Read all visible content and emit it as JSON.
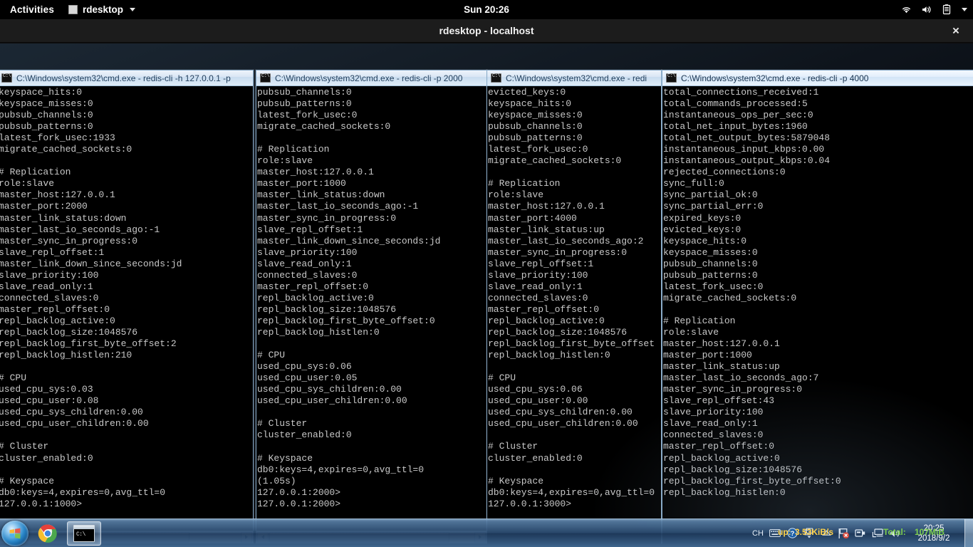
{
  "gnome_bar": {
    "activities": "Activities",
    "app_name": "rdesktop",
    "clock": "Sun 20:26",
    "tray_icons": [
      "wifi-icon",
      "volume-icon",
      "battery-icon",
      "chevron-down-icon"
    ]
  },
  "rdesktop_window": {
    "title": "rdesktop - localhost",
    "close_label": "×"
  },
  "cmd_windows": [
    {
      "title": "C:\\Windows\\system32\\cmd.exe - redis-cli  -h 127.0.0.1 -p",
      "lines": [
        "keyspace_hits:0",
        "keyspace_misses:0",
        "pubsub_channels:0",
        "pubsub_patterns:0",
        "latest_fork_usec:1933",
        "migrate_cached_sockets:0",
        "",
        "# Replication",
        "role:slave",
        "master_host:127.0.0.1",
        "master_port:2000",
        "master_link_status:down",
        "master_last_io_seconds_ago:-1",
        "master_sync_in_progress:0",
        "slave_repl_offset:1",
        "master_link_down_since_seconds:jd",
        "slave_priority:100",
        "slave_read_only:1",
        "connected_slaves:0",
        "master_repl_offset:0",
        "repl_backlog_active:0",
        "repl_backlog_size:1048576",
        "repl_backlog_first_byte_offset:2",
        "repl_backlog_histlen:210",
        "",
        "# CPU",
        "used_cpu_sys:0.03",
        "used_cpu_user:0.08",
        "used_cpu_sys_children:0.00",
        "used_cpu_user_children:0.00",
        "",
        "# Cluster",
        "cluster_enabled:0",
        "",
        "# Keyspace",
        "db0:keys=4,expires=0,avg_ttl=0",
        "127.0.0.1:1000>"
      ]
    },
    {
      "title": "C:\\Windows\\system32\\cmd.exe - redis-cli  -p 2000",
      "lines": [
        "pubsub_channels:0",
        "pubsub_patterns:0",
        "latest_fork_usec:0",
        "migrate_cached_sockets:0",
        "",
        "# Replication",
        "role:slave",
        "master_host:127.0.0.1",
        "master_port:1000",
        "master_link_status:down",
        "master_last_io_seconds_ago:-1",
        "master_sync_in_progress:0",
        "slave_repl_offset:1",
        "master_link_down_since_seconds:jd",
        "slave_priority:100",
        "slave_read_only:1",
        "connected_slaves:0",
        "master_repl_offset:0",
        "repl_backlog_active:0",
        "repl_backlog_size:1048576",
        "repl_backlog_first_byte_offset:0",
        "repl_backlog_histlen:0",
        "",
        "# CPU",
        "used_cpu_sys:0.06",
        "used_cpu_user:0.05",
        "used_cpu_sys_children:0.00",
        "used_cpu_user_children:0.00",
        "",
        "# Cluster",
        "cluster_enabled:0",
        "",
        "# Keyspace",
        "db0:keys=4,expires=0,avg_ttl=0",
        "(1.05s)",
        "127.0.0.1:2000>",
        "127.0.0.1:2000>"
      ]
    },
    {
      "title": "C:\\Windows\\system32\\cmd.exe - redi",
      "lines": [
        "evicted_keys:0",
        "keyspace_hits:0",
        "keyspace_misses:0",
        "pubsub_channels:0",
        "pubsub_patterns:0",
        "latest_fork_usec:0",
        "migrate_cached_sockets:0",
        "",
        "# Replication",
        "role:slave",
        "master_host:127.0.0.1",
        "master_port:4000",
        "master_link_status:up",
        "master_last_io_seconds_ago:2",
        "master_sync_in_progress:0",
        "slave_repl_offset:1",
        "slave_priority:100",
        "slave_read_only:1",
        "connected_slaves:0",
        "master_repl_offset:0",
        "repl_backlog_active:0",
        "repl_backlog_size:1048576",
        "repl_backlog_first_byte_offset",
        "repl_backlog_histlen:0",
        "",
        "# CPU",
        "used_cpu_sys:0.06",
        "used_cpu_user:0.00",
        "used_cpu_sys_children:0.00",
        "used_cpu_user_children:0.00",
        "",
        "# Cluster",
        "cluster_enabled:0",
        "",
        "# Keyspace",
        "db0:keys=4,expires=0,avg_ttl=0",
        "127.0.0.1:3000>"
      ]
    },
    {
      "title": "C:\\Windows\\system32\\cmd.exe - redis-cli  -p 4000",
      "lines": [
        "total_connections_received:1",
        "total_commands_processed:5",
        "instantaneous_ops_per_sec:0",
        "total_net_input_bytes:1960",
        "total_net_output_bytes:5879048",
        "instantaneous_input_kbps:0.00",
        "instantaneous_output_kbps:0.04",
        "rejected_connections:0",
        "sync_full:0",
        "sync_partial_ok:0",
        "sync_partial_err:0",
        "expired_keys:0",
        "evicted_keys:0",
        "keyspace_hits:0",
        "keyspace_misses:0",
        "pubsub_channels:0",
        "pubsub_patterns:0",
        "latest_fork_usec:0",
        "migrate_cached_sockets:0",
        "",
        "# Replication",
        "role:slave",
        "master_host:127.0.0.1",
        "master_port:1000",
        "master_link_status:up",
        "master_last_io_seconds_ago:7",
        "master_sync_in_progress:0",
        "slave_repl_offset:43",
        "slave_priority:100",
        "slave_read_only:1",
        "connected_slaves:0",
        "master_repl_offset:0",
        "repl_backlog_active:0",
        "repl_backlog_size:1048576",
        "repl_backlog_first_byte_offset:0",
        "repl_backlog_histlen:0"
      ]
    }
  ],
  "windows_taskbar": {
    "start_button": "start-orb",
    "pinned": [
      {
        "name": "chrome-taskbar-button",
        "label": "Google Chrome"
      },
      {
        "name": "cmd-taskbar-button",
        "label": "C:\\"
      }
    ],
    "tray": {
      "ime": "CH",
      "icons": [
        "keyboard-icon",
        "help-icon",
        "window-switch-icon",
        "show-hidden-icon",
        "flag-alert-icon",
        "usb-eject-icon",
        "network-icon",
        "volume-icon"
      ],
      "time": "20:25",
      "date": "2018/9/2"
    }
  },
  "net_overlay": {
    "up_label": "up:",
    "up_value": "3.53KiB/s",
    "total_label": "Total:",
    "total_value": "107MiB"
  }
}
